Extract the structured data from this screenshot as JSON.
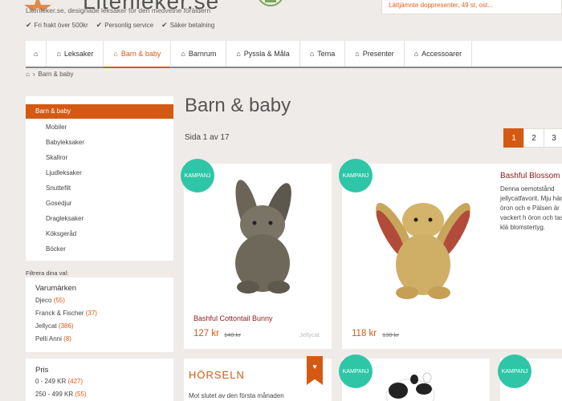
{
  "header": {
    "logo_text": "Litenleker.se",
    "tagline": "Litenleker.se, designade leksaker för den medvetne föräldern",
    "usps": [
      "Fri frakt över 500kr",
      "Personlig service",
      "Säker betalning"
    ],
    "promo": "Lättjämnte doppresenter, 49 st, ost..."
  },
  "nav": {
    "items": [
      {
        "label": "Leksaker"
      },
      {
        "label": "Barn & baby"
      },
      {
        "label": "Barnrum"
      },
      {
        "label": "Pyssla & Måla"
      },
      {
        "label": "Tema"
      },
      {
        "label": "Presenter"
      },
      {
        "label": "Accessoarer"
      }
    ]
  },
  "breadcrumb": {
    "current": "Barn & baby"
  },
  "sidebar": {
    "active": "Barn & baby",
    "subcategories": [
      "Mobiler",
      "Babyleksaker",
      "Skallror",
      "Ljudleksaker",
      "Snuttefilt",
      "Gosedjur",
      "Dragleksaker",
      "Köksgeråd",
      "Böcker"
    ],
    "filter_title": "Filtrera dina val:",
    "brands": {
      "heading": "Varumärken",
      "items": [
        {
          "name": "Djeco",
          "count": "(55)"
        },
        {
          "name": "Franck & Fischer",
          "count": "(37)"
        },
        {
          "name": "Jellycat",
          "count": "(386)"
        },
        {
          "name": "Pelli Anni",
          "count": "(8)"
        }
      ]
    },
    "price": {
      "heading": "Pris",
      "items": [
        {
          "name": "0 - 249 KR",
          "count": "(427)"
        },
        {
          "name": "250 - 499 KR",
          "count": "(55)"
        }
      ]
    }
  },
  "main": {
    "title": "Barn & baby",
    "page_count": "Sida 1 av 17",
    "pages": [
      "1",
      "2",
      "3"
    ],
    "badge": "KAMPANJ",
    "products": [
      {
        "name": "Bashful Cottontail Bunny",
        "price": "127 kr",
        "old_price": "140 kr",
        "brand": "Jellycat"
      },
      {
        "name": "Bashful Blossom",
        "price": "118 kr",
        "old_price": "130 kr",
        "description": "Denna oemotstånd jellycatfavorit. Mju härliga öron och e Pälsen är vackert h öron och tassar klä blomstertyg."
      }
    ],
    "horseln": {
      "title": "HÖRSELN",
      "text": "Mot slutet av den första månaden"
    }
  },
  "colors": {
    "accent": "#d45a14",
    "badge": "#2ec6a7",
    "product_name": "#8b1a1a"
  }
}
